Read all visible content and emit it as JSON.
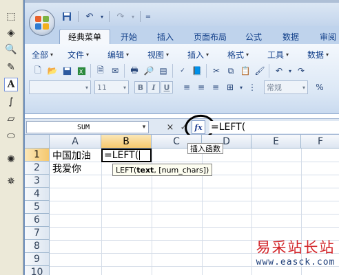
{
  "quick_access": {
    "separator_glyph": "=",
    "undo_glyph": "↶",
    "redo_glyph": "↷"
  },
  "tabs": [
    "经典菜单",
    "开始",
    "插入",
    "页面布局",
    "公式",
    "数据",
    "审阅"
  ],
  "menus": [
    "全部",
    "文件",
    "编辑",
    "视图",
    "插入",
    "格式",
    "工具",
    "数据"
  ],
  "font_size_value": "11",
  "number_format_value": "常规",
  "formula_bar": {
    "name_box": "SUM",
    "cancel_glyph": "×",
    "enter_glyph": "✓",
    "fx_label": "fx",
    "content": "=LEFT("
  },
  "column_headers": [
    "A",
    "B",
    "C",
    "D",
    "E",
    "F"
  ],
  "row_headers": [
    "1",
    "2",
    "3",
    "4",
    "5",
    "6",
    "7",
    "8",
    "9",
    "10"
  ],
  "cells": {
    "a1": "中国加油",
    "a2": "我爱你",
    "b1": "=LEFT("
  },
  "tooltips": {
    "insert_function": "插入函数",
    "function_args_name": "LEFT(",
    "function_args_current": "text",
    "function_args_rest": ", [num_chars])"
  },
  "watermark": {
    "line1": "易采站长站",
    "line2": "www.easck.com"
  },
  "colors": {
    "selected_header": "#f5c86e",
    "ribbon": "#dbe7f5",
    "tab_text": "#15428b",
    "watermark_red": "#d2252a"
  },
  "icons": [
    "rect-select-icon",
    "paint-bucket-icon",
    "magnifier-icon",
    "pencil-icon",
    "text-tool-icon",
    "curve-icon",
    "eraser-icon",
    "ellipse-icon",
    "spray-icon",
    "brush-icon"
  ]
}
